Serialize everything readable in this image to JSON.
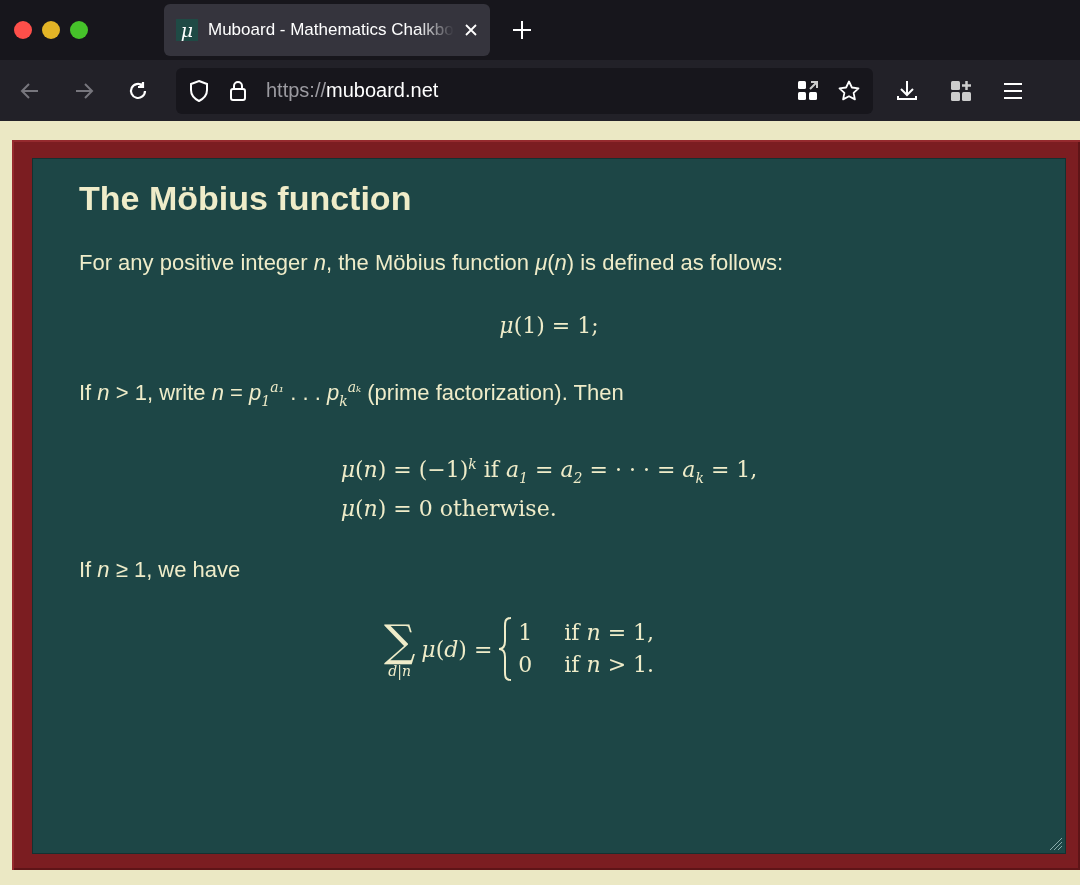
{
  "browser": {
    "tab": {
      "icon": "μ",
      "title": "Muboard - Mathematics Chalkbo",
      "selected": true
    },
    "url": {
      "scheme": "https://",
      "host": "muboard.net"
    }
  },
  "board": {
    "title": "The Möbius function",
    "blocks": [
      {
        "kind": "text",
        "text": "For any positive integer *n*, the Möbius function *μ*(*n*) is defined as follows:"
      },
      {
        "kind": "math",
        "lines": [
          "*μ*(1) = 1;"
        ]
      },
      {
        "kind": "text",
        "text": "If *n* > 1, write *n* = *p*$_{1}$$^{a₁}$ . . . *p*$_{k}$$^{aₖ}$ (prime factorization). Then"
      },
      {
        "kind": "math",
        "lines": [
          "*μ*(*n*) = (−1)$^{k}$ if *a*$_{1}$ = *a*$_{2}$ = · · · = *a*$_{k}$ = 1,",
          "*μ*(*n*) = 0 otherwise."
        ]
      },
      {
        "kind": "text",
        "text": "If *n* ≥ 1, we have"
      },
      {
        "kind": "sum",
        "operator": "∑",
        "index": "d|n",
        "lhs": "*μ*(*d*) =",
        "cases": [
          {
            "value": "1",
            "condition": "if *n* = 1,"
          },
          {
            "value": "0",
            "condition": "if *n* > 1."
          }
        ]
      }
    ]
  }
}
